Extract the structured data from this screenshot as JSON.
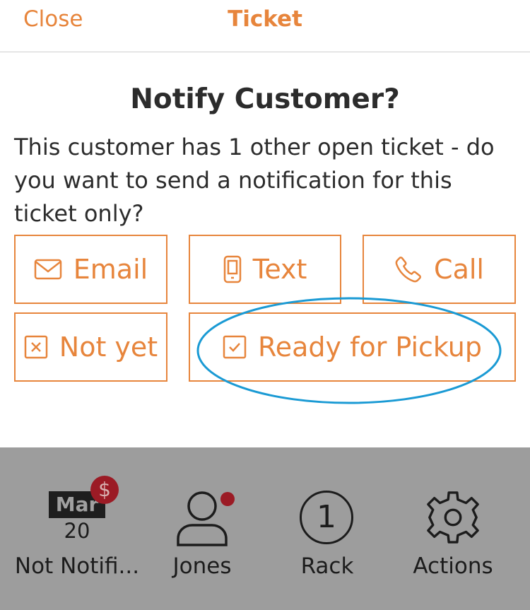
{
  "header": {
    "close_label": "Close",
    "title": "Ticket"
  },
  "dialog": {
    "title": "Notify Customer?",
    "message": "This customer has 1 other open ticket - do you want to send a notification for this ticket only?"
  },
  "options": {
    "email": "Email",
    "text": "Text",
    "call": "Call",
    "not_yet": "Not yet",
    "ready": "Ready for Pickup"
  },
  "tabs": {
    "date": {
      "month": "Mar",
      "day": "20",
      "label": "Not Notifi...",
      "badge": "$"
    },
    "customer": {
      "label": "Jones"
    },
    "rack": {
      "number": "1",
      "label": "Rack"
    },
    "actions": {
      "label": "Actions"
    }
  },
  "colors": {
    "accent": "#e7853c",
    "highlight": "#1a9ad4",
    "tab_bar": "#9d9d9d",
    "badge": "#9b1b25"
  }
}
